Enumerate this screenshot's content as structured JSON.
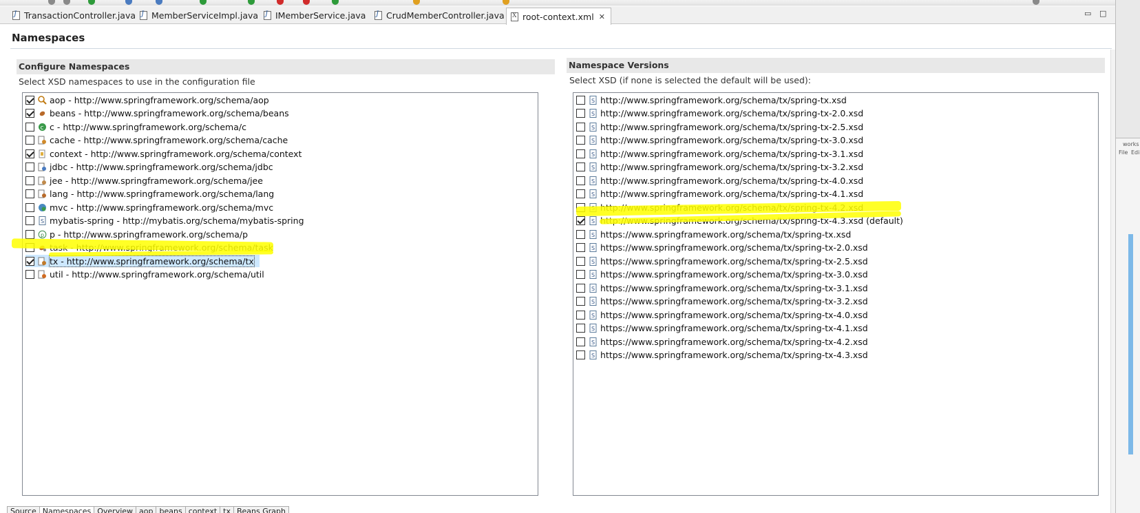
{
  "tabs": [
    {
      "label": "TransactionController.java",
      "icon": "java-file-icon"
    },
    {
      "label": "MemberServiceImpl.java",
      "icon": "java-file-icon"
    },
    {
      "label": "IMemberService.java",
      "icon": "java-file-icon"
    },
    {
      "label": "CrudMemberController.java",
      "icon": "java-file-icon"
    },
    {
      "label": "root-context.xml",
      "icon": "xml-file-icon",
      "active": true
    }
  ],
  "page": {
    "title": "Namespaces"
  },
  "left": {
    "heading": "Configure Namespaces",
    "description": "Select XSD namespaces to use in the configuration file",
    "items": [
      {
        "label": "aop - http://www.springframework.org/schema/aop",
        "checked": true,
        "icon": "aop-icon"
      },
      {
        "label": "beans - http://www.springframework.org/schema/beans",
        "checked": true,
        "icon": "bean-icon"
      },
      {
        "label": "c - http://www.springframework.org/schema/c",
        "checked": false,
        "icon": "c-namespace-icon"
      },
      {
        "label": "cache - http://www.springframework.org/schema/cache",
        "checked": false,
        "icon": "cache-icon"
      },
      {
        "label": "context - http://www.springframework.org/schema/context",
        "checked": true,
        "icon": "context-icon"
      },
      {
        "label": "jdbc - http://www.springframework.org/schema/jdbc",
        "checked": false,
        "icon": "jdbc-icon"
      },
      {
        "label": "jee - http://www.springframework.org/schema/jee",
        "checked": false,
        "icon": "jee-icon"
      },
      {
        "label": "lang - http://www.springframework.org/schema/lang",
        "checked": false,
        "icon": "lang-icon"
      },
      {
        "label": "mvc - http://www.springframework.org/schema/mvc",
        "checked": false,
        "icon": "mvc-icon"
      },
      {
        "label": "mybatis-spring - http://mybatis.org/schema/mybatis-spring",
        "checked": false,
        "icon": "xsd-file-icon"
      },
      {
        "label": "p - http://www.springframework.org/schema/p",
        "checked": false,
        "icon": "p-namespace-icon"
      },
      {
        "label": "task - http://www.springframework.org/schema/task",
        "checked": false,
        "icon": "task-icon"
      },
      {
        "label": "tx - http://www.springframework.org/schema/tx",
        "checked": true,
        "icon": "tx-icon",
        "selected": true
      },
      {
        "label": "util - http://www.springframework.org/schema/util",
        "checked": false,
        "icon": "util-icon"
      }
    ]
  },
  "right": {
    "heading": "Namespace Versions",
    "description": "Select XSD (if none is selected the default will be used):",
    "items": [
      {
        "label": "http://www.springframework.org/schema/tx/spring-tx.xsd",
        "checked": false
      },
      {
        "label": "http://www.springframework.org/schema/tx/spring-tx-2.0.xsd",
        "checked": false
      },
      {
        "label": "http://www.springframework.org/schema/tx/spring-tx-2.5.xsd",
        "checked": false
      },
      {
        "label": "http://www.springframework.org/schema/tx/spring-tx-3.0.xsd",
        "checked": false
      },
      {
        "label": "http://www.springframework.org/schema/tx/spring-tx-3.1.xsd",
        "checked": false
      },
      {
        "label": "http://www.springframework.org/schema/tx/spring-tx-3.2.xsd",
        "checked": false
      },
      {
        "label": "http://www.springframework.org/schema/tx/spring-tx-4.0.xsd",
        "checked": false
      },
      {
        "label": "http://www.springframework.org/schema/tx/spring-tx-4.1.xsd",
        "checked": false
      },
      {
        "label": "http://www.springframework.org/schema/tx/spring-tx-4.2.xsd",
        "checked": false
      },
      {
        "label": "http://www.springframework.org/schema/tx/spring-tx-4.3.xsd (default)",
        "checked": true
      },
      {
        "label": "https://www.springframework.org/schema/tx/spring-tx.xsd",
        "checked": false
      },
      {
        "label": "https://www.springframework.org/schema/tx/spring-tx-2.0.xsd",
        "checked": false
      },
      {
        "label": "https://www.springframework.org/schema/tx/spring-tx-2.5.xsd",
        "checked": false
      },
      {
        "label": "https://www.springframework.org/schema/tx/spring-tx-3.0.xsd",
        "checked": false
      },
      {
        "label": "https://www.springframework.org/schema/tx/spring-tx-3.1.xsd",
        "checked": false
      },
      {
        "label": "https://www.springframework.org/schema/tx/spring-tx-3.2.xsd",
        "checked": false
      },
      {
        "label": "https://www.springframework.org/schema/tx/spring-tx-4.0.xsd",
        "checked": false
      },
      {
        "label": "https://www.springframework.org/schema/tx/spring-tx-4.1.xsd",
        "checked": false
      },
      {
        "label": "https://www.springframework.org/schema/tx/spring-tx-4.2.xsd",
        "checked": false
      },
      {
        "label": "https://www.springframework.org/schema/tx/spring-tx-4.3.xsd",
        "checked": false
      }
    ]
  },
  "bottom_tabs": [
    {
      "label": "Source"
    },
    {
      "label": "Namespaces",
      "active": true
    },
    {
      "label": "Overview"
    },
    {
      "label": "aop"
    },
    {
      "label": "beans"
    },
    {
      "label": "context"
    },
    {
      "label": "tx"
    },
    {
      "label": "Beans Graph"
    }
  ],
  "side_window": {
    "title": "works",
    "menu_file": "File",
    "menu_edit": "Edi"
  },
  "colors": {
    "highlight": "#ffff00",
    "selection": "#cde8ff",
    "section_bg": "#e8e8e8"
  }
}
